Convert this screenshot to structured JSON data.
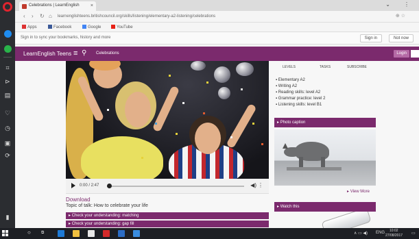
{
  "browser": {
    "tab_title": "Celebrations | LearnEnglish",
    "url": "learnenglishteens.britishcouncil.org/skills/listening/elementary-a2-listening/celebrations",
    "bookmarks": [
      "Apps",
      "Facebook",
      "Google",
      "YouTube"
    ],
    "infobar_text": "Sign in to sync your bookmarks, history and more",
    "infobar_buttons": [
      "Sign in",
      "Not now"
    ]
  },
  "site": {
    "logo": "LearnEnglish Teens",
    "header_link": "Celebrations",
    "login_label": "Login"
  },
  "player": {
    "time": "0:00 / 2:47"
  },
  "main": {
    "download_label": "Download",
    "subtext": "Topic of talk: How to celebrate your life",
    "check_bars": [
      "Check your understanding: matching",
      "Check your understanding: gap fill"
    ]
  },
  "sidebar": {
    "tabs": [
      "LEVELS",
      "TASKS",
      "SUBSCRIBE"
    ],
    "list": [
      "Elementary A2",
      "Writing A2",
      "Reading skills: level A2",
      "Grammar practice: level 2",
      "Listening skills: level B1"
    ],
    "photo_caption": "Photo caption",
    "view_more": "View More",
    "section2": "Watch this"
  },
  "taskbar": {
    "clock_time": "10:02",
    "clock_date": "27/08/2017",
    "lang": "ENG"
  }
}
